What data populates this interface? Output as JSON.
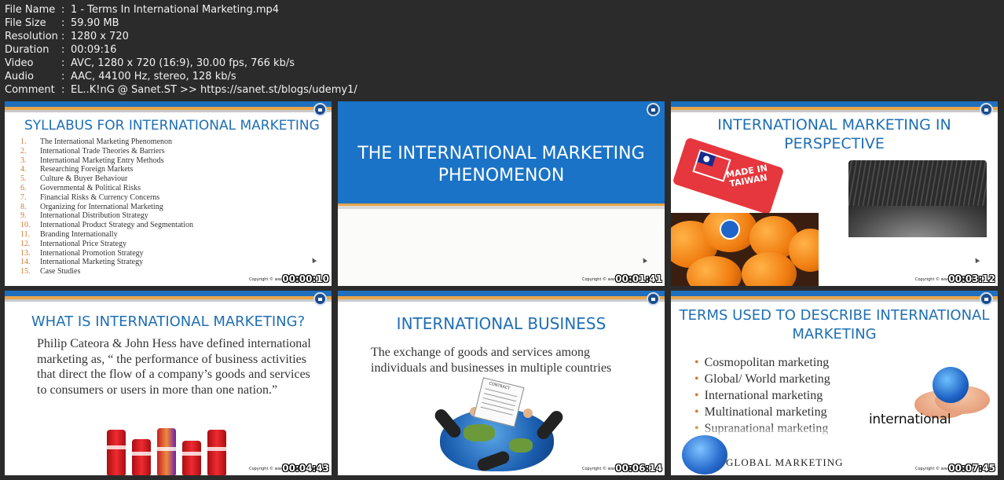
{
  "file_info": [
    {
      "key": "File Name",
      "value": "1 - Terms In International Marketing.mp4"
    },
    {
      "key": "File Size",
      "value": "59.90 MB"
    },
    {
      "key": "Resolution",
      "value": "1280 x 720"
    },
    {
      "key": "Duration",
      "value": "00:09:16"
    },
    {
      "key": "Video",
      "value": "AVC, 1280 x 720 (16:9), 30.00 fps, 766 kb/s"
    },
    {
      "key": "Audio",
      "value": "AAC, 44100 Hz, stereo, 128 kb/s"
    },
    {
      "key": "Comment",
      "value": "EL..K!nG @ Sanet.ST >> https://sanet.st/blogs/udemy1/"
    }
  ],
  "separator": ":",
  "copyright_text": "Copyright © www.educo",
  "thumbnails": [
    {
      "timestamp": "00:00:10",
      "title": "SYLLABUS FOR INTERNATIONAL MARKETING",
      "items": [
        {
          "num": "1.",
          "text": "The International Marketing Phenomenon"
        },
        {
          "num": "2.",
          "text": "International Trade Theories & Barriers"
        },
        {
          "num": "3.",
          "text": "International Marketing Entry Methods"
        },
        {
          "num": "4.",
          "text": "Researching Foreign Markets"
        },
        {
          "num": "5.",
          "text": "Culture & Buyer Behaviour"
        },
        {
          "num": "6.",
          "text": "Governmental & Political Risks"
        },
        {
          "num": "7.",
          "text": "Financial Risks & Currency Concerns"
        },
        {
          "num": "8.",
          "text": "Organizing for International Marketing"
        },
        {
          "num": "9.",
          "text": "International Distribution Strategy"
        },
        {
          "num": "10.",
          "text": "International Product Strategy and Segmentation"
        },
        {
          "num": "11.",
          "text": "Branding Internationally"
        },
        {
          "num": "12.",
          "text": "International Price Strategy"
        },
        {
          "num": "13.",
          "text": "International Promotion Strategy"
        },
        {
          "num": "14.",
          "text": "International Marketing Strategy"
        },
        {
          "num": "15.",
          "text": "Case Studies"
        }
      ]
    },
    {
      "timestamp": "00:01:41",
      "title_line1": "THE INTERNATIONAL MARKETING",
      "title_line2": "PHENOMENON"
    },
    {
      "timestamp": "00:03:12",
      "title_line1": "INTERNATIONAL MARKETING IN",
      "title_line2": "PERSPECTIVE",
      "tag_text_line1": "MADE IN",
      "tag_text_line2": "TAIWAN"
    },
    {
      "timestamp": "00:04:43",
      "title": "WHAT IS INTERNATIONAL MARKETING?",
      "body": "Philip Cateora & John Hess have defined international marketing as, “ the performance of business activities that direct the flow of a company’s goods and services to consumers or users in more than one nation.”"
    },
    {
      "timestamp": "00:06:14",
      "title": "INTERNATIONAL BUSINESS",
      "body_line1": "The exchange of goods and services among",
      "body_line2": "individuals and businesses in multiple countries",
      "contract_label": "CONTRACT"
    },
    {
      "timestamp": "00:07:45",
      "title_line1": "TERMS USED TO DESCRIBE INTERNATIONAL",
      "title_line2": "MARKETING",
      "bullets": [
        "Cosmopolitan marketing",
        "Global/ World marketing",
        "International marketing",
        "Multinational marketing",
        "Supranational marketing"
      ],
      "logo_word": "international",
      "global_label": "GLOBAL MARKETING"
    }
  ]
}
